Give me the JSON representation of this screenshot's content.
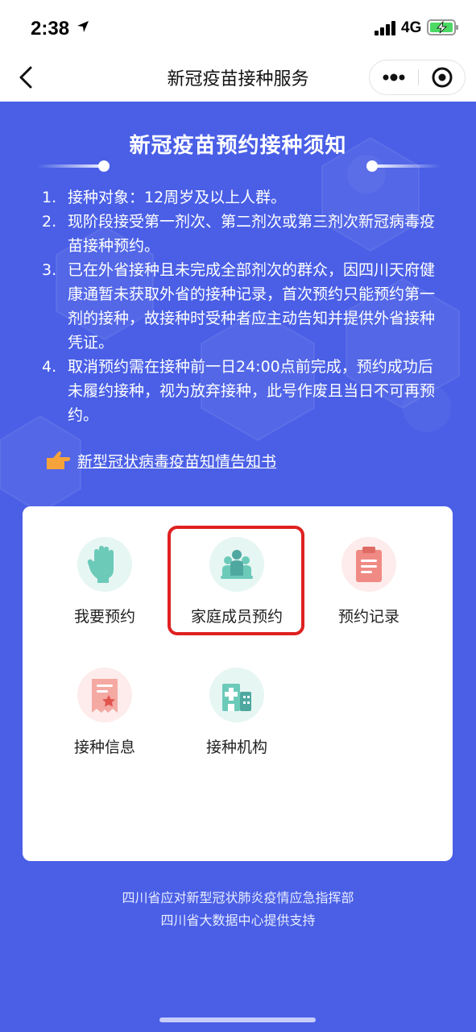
{
  "status_bar": {
    "time": "2:38",
    "network": "4G"
  },
  "nav": {
    "title": "新冠疫苗接种服务"
  },
  "notice": {
    "title": "新冠疫苗预约接种须知",
    "items": [
      {
        "num": "1.",
        "text": "接种对象：12周岁及以上人群。"
      },
      {
        "num": "2.",
        "text": "现阶段接受第一剂次、第二剂次或第三剂次新冠病毒疫苗接种预约。"
      },
      {
        "num": "3.",
        "text": "已在外省接种且未完成全部剂次的群众，因四川天府健康通暂未获取外省的接种记录，首次预约只能预约第一剂的接种，故接种时受种者应主动告知并提供外省接种凭证。"
      },
      {
        "num": "4.",
        "text": "取消预约需在接种前一日24:00点前完成，预约成功后未履约接种，视为放弃接种，此号作废且当日不可再预约。"
      }
    ],
    "consent_link": "新型冠状病毒疫苗知情告知书"
  },
  "services": {
    "items": [
      {
        "label": "我要预约",
        "icon": "hand-icon",
        "bg": "#e6f6f3"
      },
      {
        "label": "家庭成员预约",
        "icon": "family-icon",
        "bg": "#e6f6f3"
      },
      {
        "label": "预约记录",
        "icon": "clipboard-icon",
        "bg": "#fdeceb"
      },
      {
        "label": "接种信息",
        "icon": "certificate-icon",
        "bg": "#fdeceb"
      },
      {
        "label": "接种机构",
        "icon": "hospital-icon",
        "bg": "#e6f6f3"
      }
    ],
    "highlighted": "家庭成员预约"
  },
  "footer": {
    "line1": "四川省应对新型冠状肺炎疫情应急指挥部",
    "line2": "四川省大数据中心提供支持"
  },
  "colors": {
    "primary": "#4a5fe6",
    "teal": "#6ccab9",
    "coral": "#f08a84",
    "highlight": "#e02020",
    "pointer": "#f5a23b"
  }
}
